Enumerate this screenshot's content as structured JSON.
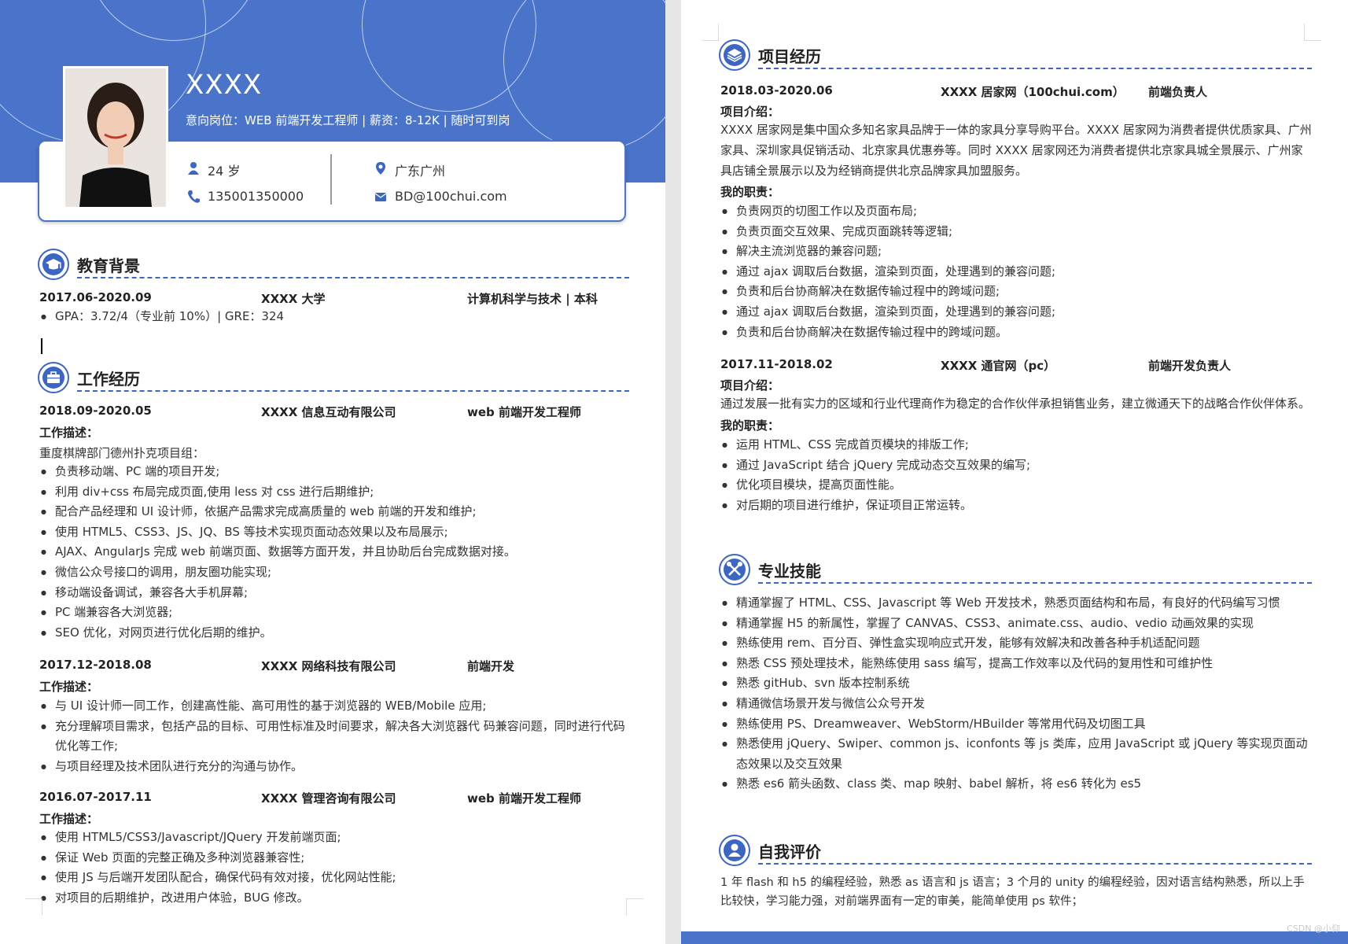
{
  "header": {
    "name": "XXXX",
    "intent": "意向岗位：WEB 前端开发工程师 | 薪资：8-12K | 随时可到岗",
    "age": "24 岁",
    "phone": "135001350000",
    "location": "广东广州",
    "email": "BD@100chui.com"
  },
  "sections": {
    "education": "教育背景",
    "work": "工作经历",
    "projects": "项目经历",
    "skills": "专业技能",
    "self": "自我评价"
  },
  "education": {
    "date": "2017.06-2020.09",
    "school": "XXXX 大学",
    "major": "计算机科学与技术 | 本科",
    "details": [
      "GPA：3.72/4（专业前 10%）| GRE：324"
    ]
  },
  "work": [
    {
      "date": "2018.09-2020.05",
      "company": "XXXX 信息互动有限公司",
      "role": "web 前端开发工程师",
      "desc_label": "工作描述：",
      "intro": "重度棋牌部门德州扑克项目组：",
      "items": [
        "负责移动端、PC 端的项目开发;",
        "利用 div+css 布局完成页面,使用 less 对 css 进行后期维护;",
        "配合产品经理和 UI 设计师，依据产品需求完成高质量的 web 前端的开发和维护;",
        "使用 HTML5、CSS3、JS、JQ、BS 等技术实现页面动态效果以及布局展示;",
        "AJAX、AngularJs 完成 web 前端页面、数据等方面开发，并且协助后台完成数据对接。",
        "微信公众号接口的调用，朋友圈功能实现;",
        "移动端设备调试，兼容各大手机屏幕;",
        "PC 端兼容各大浏览器;",
        "SEO 优化，对网页进行优化后期的维护。"
      ]
    },
    {
      "date": "2017.12-2018.08",
      "company": "XXXX 网络科技有限公司",
      "role": "前端开发",
      "desc_label": "工作描述：",
      "items": [
        "与 UI 设计师一同工作，创建高性能、高可用性的基于浏览器的 WEB/Mobile 应用;",
        "充分理解项目需求，包括产品的目标、可用性标准及时间要求，解决各大浏览器代  码兼容问题，同时进行代码优化等工作;",
        "与项目经理及技术团队进行充分的沟通与协作。"
      ]
    },
    {
      "date": "2016.07-2017.11",
      "company": "XXXX 管理咨询有限公司",
      "role": "web 前端开发工程师",
      "desc_label": "工作描述：",
      "items": [
        "使用 HTML5/CSS3/Javascript/JQuery 开发前端页面;",
        "保证 Web 页面的完整正确及多种浏览器兼容性;",
        "使用 JS  与后端开发团队配合，确保代码有效对接，优化网站性能;",
        "对项目的后期维护，改进用户体验，BUG 修改。"
      ]
    }
  ],
  "projects": [
    {
      "date": "2018.03-2020.06",
      "name": "XXXX 居家网（100chui.com）",
      "role": "前端负责人",
      "intro_label": "项目介绍：",
      "intro": "XXXX 居家网是集中国众多知名家具品牌于一体的家具分享导购平台。XXXX 居家网为消费者提供优质家具、广州家具、深圳家具促销活动、北京家具优惠券等。同时 XXXX 居家网还为消费者提供北京家具城全景展示、广州家具店铺全景展示以及为经销商提供北京品牌家具加盟服务。",
      "duty_label": "我的职责：",
      "items": [
        "负责网页的切图工作以及页面布局;",
        "负责页面交互效果、完成页面跳转等逻辑;",
        "解决主流浏览器的兼容问题;",
        "通过 ajax 调取后台数据，渲染到页面，处理遇到的兼容问题;",
        "负责和后台协商解决在数据传输过程中的跨域问题;",
        "通过 ajax 调取后台数据，渲染到页面，处理遇到的兼容问题;",
        "负责和后台协商解决在数据传输过程中的跨域问题。"
      ]
    },
    {
      "date": "2017.11-2018.02",
      "name": "XXXX 通官网（pc）",
      "role": "前端开发负责人",
      "intro_label": "项目介绍：",
      "intro": "通过发展一批有实力的区域和行业代理商作为稳定的合作伙伴承担销售业务，建立微通天下的战略合作伙伴体系。",
      "duty_label": "我的职责：",
      "items": [
        "运用 HTML、CSS 完成首页模块的排版工作;",
        "通过 JavaScript 结合 jQuery 完成动态交互效果的编写;",
        "优化项目模块，提高页面性能。",
        "对后期的项目进行维护，保证项目正常运转。"
      ]
    }
  ],
  "skills": [
    "精通掌握了 HTML、CSS、Javascript 等 Web 开发技术，熟悉页面结构和布局，有良好的代码编写习惯",
    "精通掌握 H5 的新属性，掌握了 CANVAS、CSS3、animate.css、audio、vedio 动画效果的实现",
    "熟练使用 rem、百分百、弹性盒实现响应式开发，能够有效解决和改善各种手机适配问题",
    "熟悉 CSS 预处理技术，能熟练使用 sass 编写，提高工作效率以及代码的复用性和可维护性",
    "熟悉 gitHub、svn 版本控制系统",
    "精通微信场景开发与微信公众号开发",
    "熟练使用 PS、Dreamweaver、WebStorm/HBuilder 等常用代码及切图工具",
    "熟悉使用 jQuery、Swiper、common js、iconfonts 等 js 类库，应用 JavaScript 或 jQuery 等实现页面动态效果以及交互效果",
    "熟悉 es6 箭头函数、class 类、map 映射、babel 解析，将 es6 转化为 es5"
  ],
  "self_eval": "1 年 flash 和 h5 的编程经验，熟悉 as 语言和 js 语言；3 个月的 unity 的编程经验，因对语言结构熟悉，所以上手比较快，学习能力强，对前端界面有一定的审美，能简单使用 ps 软件；",
  "watermark": "CSDN @小仰"
}
